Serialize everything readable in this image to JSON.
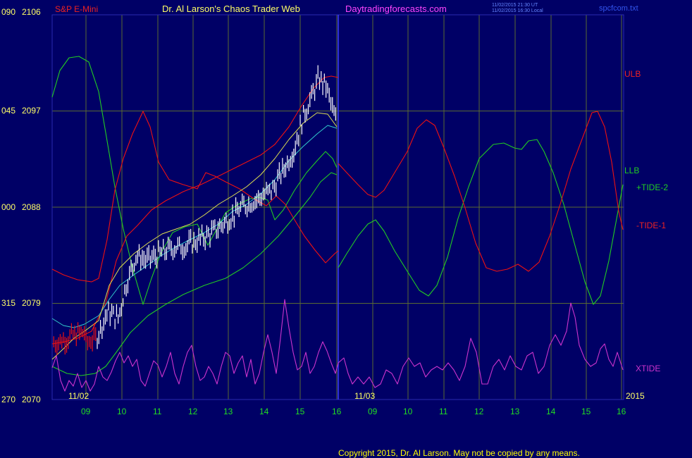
{
  "header": {
    "instrument": "S&P E-Mini",
    "author": "Dr. Al Larson's Chaos Trader Web",
    "site": "Daytradingforecasts.com",
    "timestamp_line1": "11/02/2015 21:30 UT",
    "timestamp_line2": "11/02/2015 16:30 Local",
    "file": "spcfcom.txt"
  },
  "colors": {
    "background": "#000066",
    "plot_border": "#2a2ab0",
    "grid": "#5a6a32",
    "divider": "#3a3aff",
    "price": "#ffffff",
    "ulb": "#ee1111",
    "llb": "#22cc22",
    "tide_plus": "#22cc22",
    "tide_minus": "#ee1111",
    "xtide": "#cc33cc",
    "ma_cyan": "#33cccc",
    "ma_yellow": "#e0e050",
    "date_label": "#ffff66",
    "hour_label": "#22dd22",
    "axis_label": "#ffff66",
    "copyright": "#ffff00"
  },
  "chart_data": {
    "type": "line",
    "title": "S&P E-Mini",
    "y_axis_right_labels": [
      "2106",
      "2097",
      "2088",
      "2079",
      "2070"
    ],
    "y_axis_left_labels": [
      "090",
      "045",
      "000",
      "315",
      "270"
    ],
    "ylim": [
      2070,
      2106
    ],
    "x_hour_ticks": [
      "09",
      "10",
      "11",
      "12",
      "13",
      "14",
      "15",
      "16",
      "09",
      "10",
      "11",
      "12",
      "13",
      "14",
      "15",
      "16"
    ],
    "date_labels": [
      "11/02",
      "11/03"
    ],
    "year_label": "2015",
    "series_labels": {
      "ulb": "ULB",
      "llb": "LLB",
      "tide_plus": "+TIDE-2",
      "tide_minus": "-TIDE-1",
      "xtide": "XTIDE"
    },
    "price_sample": [
      {
        "x": 0.0,
        "y": 2075.3
      },
      {
        "x": 0.3,
        "y": 2075.8
      },
      {
        "x": 0.6,
        "y": 2078.2
      },
      {
        "x": 0.9,
        "y": 2077.6
      },
      {
        "x": 1.1,
        "y": 2080.5
      },
      {
        "x": 1.4,
        "y": 2083.5
      },
      {
        "x": 1.7,
        "y": 2083.0
      },
      {
        "x": 2.0,
        "y": 2083.5
      },
      {
        "x": 2.4,
        "y": 2084.2
      },
      {
        "x": 2.8,
        "y": 2084.4
      },
      {
        "x": 3.2,
        "y": 2085.0
      },
      {
        "x": 3.6,
        "y": 2085.8
      },
      {
        "x": 4.0,
        "y": 2086.9
      },
      {
        "x": 4.4,
        "y": 2088.1
      },
      {
        "x": 4.8,
        "y": 2088.8
      },
      {
        "x": 5.2,
        "y": 2089.6
      },
      {
        "x": 5.5,
        "y": 2091.4
      },
      {
        "x": 5.8,
        "y": 2093.3
      },
      {
        "x": 6.1,
        "y": 2096.8
      },
      {
        "x": 6.3,
        "y": 2098.3
      },
      {
        "x": 6.5,
        "y": 2100.0
      },
      {
        "x": 6.7,
        "y": 2099.4
      },
      {
        "x": 6.9,
        "y": 2097.0
      },
      {
        "x": 7.0,
        "y": 2095.8
      }
    ],
    "copyright": "Copyright 2015, Dr. Al Larson. May not be copied by any means."
  }
}
